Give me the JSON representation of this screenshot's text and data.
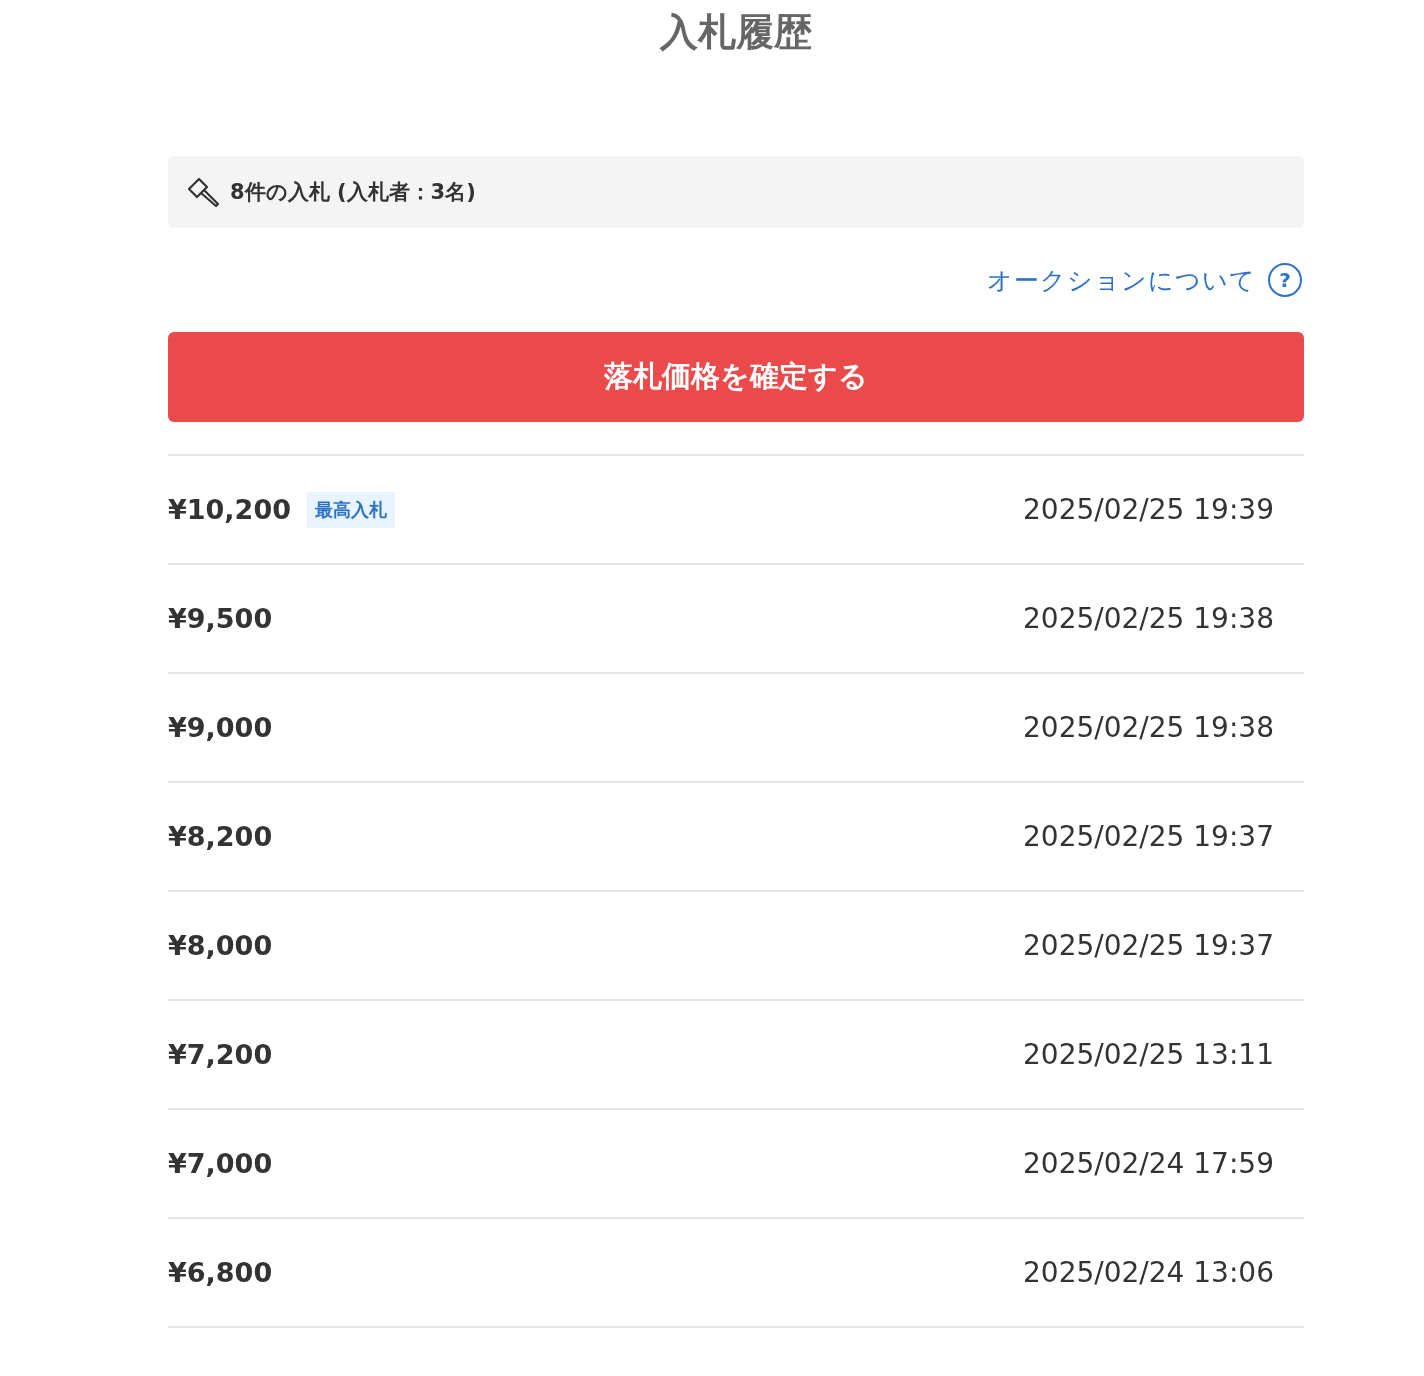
{
  "title": "入札履歴",
  "summary": "8件の入札 (入札者：3名)",
  "help_link": "オークションについて",
  "help_icon": "?",
  "confirm_button": "落札価格を確定する",
  "bids": [
    {
      "price": "¥10,200",
      "badge": "最高入札",
      "time": "2025/02/25 19:39"
    },
    {
      "price": "¥9,500",
      "time": "2025/02/25 19:38"
    },
    {
      "price": "¥9,000",
      "time": "2025/02/25 19:38"
    },
    {
      "price": "¥8,200",
      "time": "2025/02/25 19:37"
    },
    {
      "price": "¥8,000",
      "time": "2025/02/25 19:37"
    },
    {
      "price": "¥7,200",
      "time": "2025/02/25 13:11"
    },
    {
      "price": "¥7,000",
      "time": "2025/02/24 17:59"
    },
    {
      "price": "¥6,800",
      "time": "2025/02/24 13:06"
    }
  ]
}
